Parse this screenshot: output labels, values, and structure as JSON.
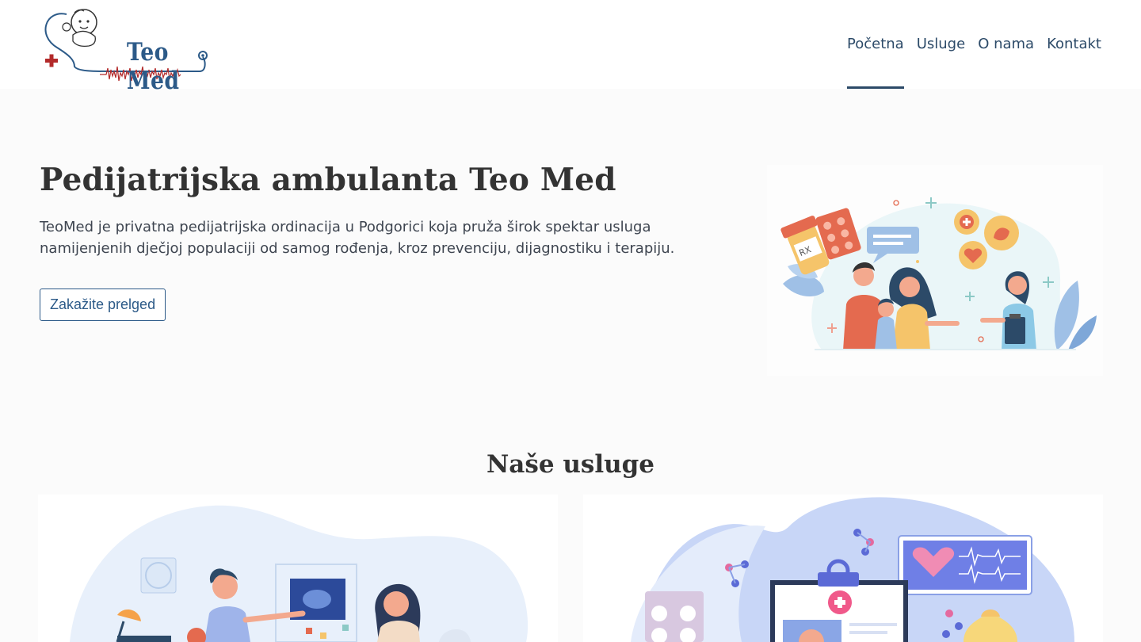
{
  "header": {
    "logo_text": "Teo Med",
    "nav": [
      {
        "label": "Početna",
        "active": true
      },
      {
        "label": "Usluge"
      },
      {
        "label": "O nama"
      },
      {
        "label": "Kontakt"
      }
    ]
  },
  "hero": {
    "title": "Pedijatrijska ambulanta Teo Med",
    "text": "TeoMed je privatna pedijatrijska ordinacija u Podgorici koja pruža širok spektar usluga namijenjenih dječjoj populaciji od samog rođenja, kroz prevenciju, dijagnostiku i terapiju.",
    "cta_label": "Zakažite prelged",
    "rx_label": "RX"
  },
  "services": {
    "title": "Naše usluge"
  },
  "colors": {
    "brand_blue": "#2c5a88",
    "brand_red": "#b32a2a",
    "nav_text": "#2c4a68",
    "page_bg": "#fbfbfb"
  },
  "icons": [
    "logo-baby-stethoscope-icon",
    "heartbeat-line-icon",
    "medical-cross-icon"
  ]
}
